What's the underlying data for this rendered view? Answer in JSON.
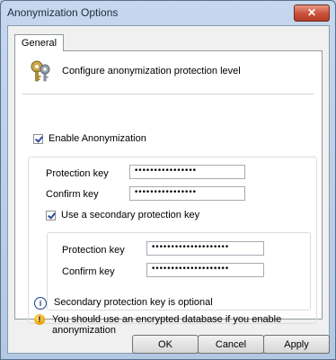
{
  "window": {
    "title": "Anonymization Options"
  },
  "tabs": [
    {
      "label": "General"
    }
  ],
  "header": {
    "text": "Configure anonymization protection level",
    "icon": "keys-icon"
  },
  "enable_anonymization": {
    "label": "Enable Anonymization",
    "checked": true
  },
  "primary": {
    "protection_key_label": "Protection key",
    "protection_key_value": "••••••••••••••••",
    "confirm_key_label": "Confirm key",
    "confirm_key_value": "••••••••••••••••"
  },
  "use_secondary": {
    "label": "Use a secondary protection key",
    "checked": true
  },
  "secondary": {
    "protection_key_label": "Protection key",
    "protection_key_value": "••••••••••••••••••••",
    "confirm_key_label": "Confirm key",
    "confirm_key_value": "••••••••••••••••••••"
  },
  "info_note": "Secondary protection key is optional",
  "warning_note": "You should use an encrypted database if you enable anonymization",
  "buttons": {
    "ok": "OK",
    "cancel": "Cancel",
    "apply": "Apply"
  },
  "colors": {
    "close_button": "#c9503a",
    "info_icon": "#1c3f8c",
    "warning_icon": "#f0a400"
  }
}
